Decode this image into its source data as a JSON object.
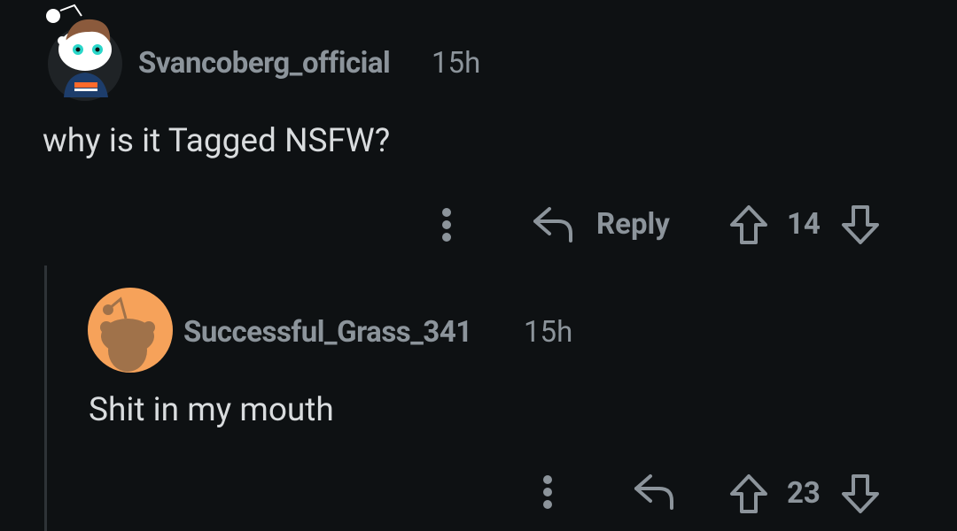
{
  "comments": [
    {
      "username": "Svancoberg_official",
      "time": "15h",
      "text": "why is it Tagged NSFW?",
      "reply_label": "Reply",
      "vote_count": "14"
    },
    {
      "username": "Successful_Grass_341",
      "time": "15h",
      "text": "Shit in my mouth",
      "vote_count": "23"
    }
  ],
  "colors": {
    "background": "#0e1113",
    "muted_text": "#8c949b",
    "body_text": "#d9dcde",
    "avatar2_bg": "#f6a25a"
  },
  "icons": [
    "snoo-avatar",
    "snoo-silhouette-avatar",
    "more-vertical-icon",
    "reply-arrow-icon",
    "upvote-arrow-icon",
    "downvote-arrow-icon"
  ]
}
